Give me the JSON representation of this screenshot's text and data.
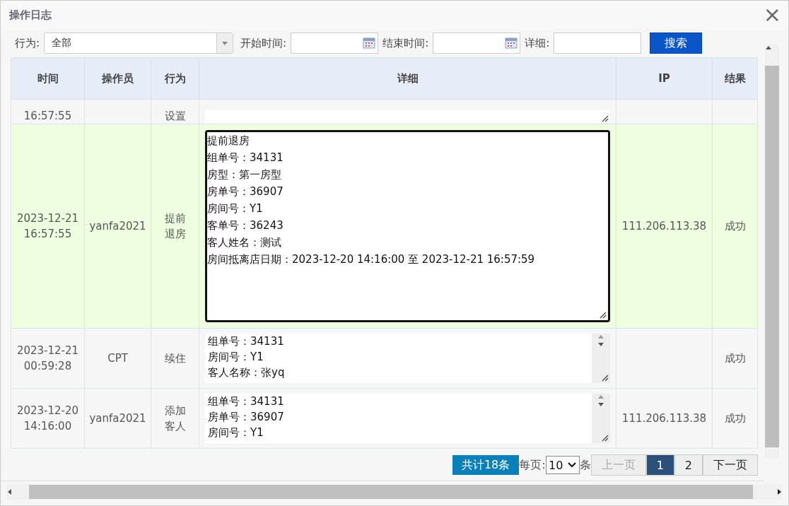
{
  "window": {
    "title": "操作日志",
    "close": "×"
  },
  "filters": {
    "action_label": "行为:",
    "action_value": "全部",
    "start_label": "开始时间:",
    "end_label": "结束时间:",
    "detail_label": "详细:",
    "search_button": "搜索"
  },
  "table": {
    "columns": [
      "时间",
      "操作员",
      "行为",
      "详细",
      "IP",
      "结果"
    ],
    "rows": [
      {
        "time": "16:57:55",
        "action": "设置",
        "selected": false
      },
      {
        "time": "2023-12-21 16:57:55",
        "operator": "yanfa2021",
        "action": "提前退房",
        "detail": [
          "提前退房",
          "组单号：34131",
          "房型：第一房型",
          "房单号：36907",
          "房间号：Y1",
          "客单号：36243",
          "客人姓名：测试",
          "房间抵离店日期：2023-12-20 14:16:00 至 2023-12-21 16:57:59"
        ],
        "ip": "111.206.113.38",
        "result": "成功",
        "selected": true
      },
      {
        "time": "2023-12-21 00:59:28",
        "operator": "CPT",
        "action": "续住",
        "detail": [
          "组单号：34131",
          "房间号：Y1",
          "客人名称：张yq"
        ],
        "result": "成功",
        "selected": false
      },
      {
        "time": "2023-12-20 14:16:00",
        "operator": "yanfa2021",
        "action": "添加客人",
        "detail": [
          "组单号：34131",
          "房单号：36907",
          "房间号：Y1"
        ],
        "ip": "111.206.113.38",
        "result": "成功",
        "selected": false
      }
    ]
  },
  "pagination": {
    "total": "共计18条",
    "per_page_label": "每页:",
    "per_page_value": "10",
    "per_page_unit": "条",
    "prev": "上一页",
    "prev_disabled": true,
    "pages": [
      {
        "label": "1",
        "selected": true
      },
      {
        "label": "2",
        "selected": false
      }
    ],
    "next": "下一页"
  }
}
